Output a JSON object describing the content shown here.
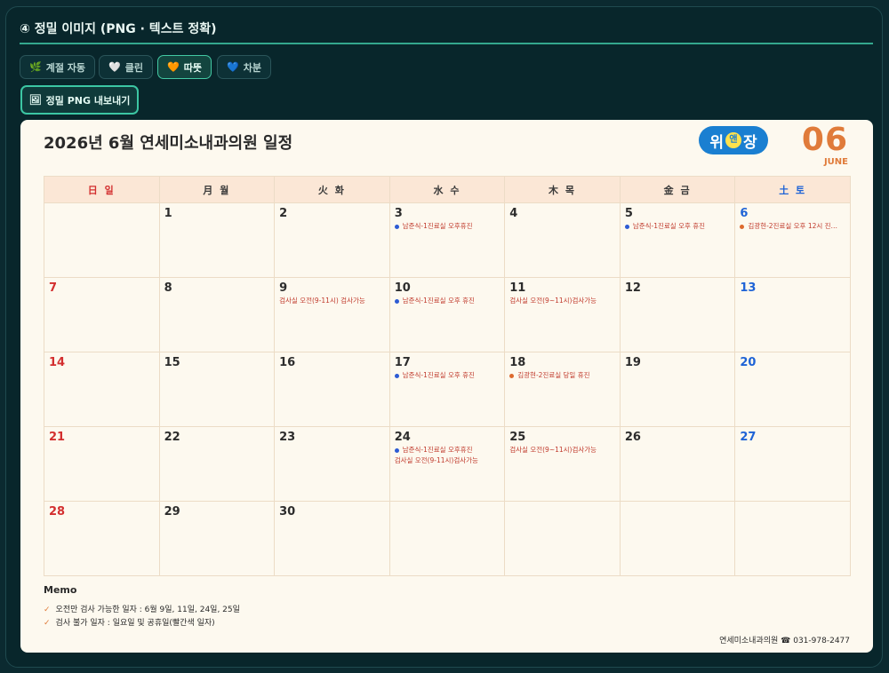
{
  "panel": {
    "title": "④ 정밀 이미지 (PNG · 텍스트 정확)"
  },
  "chips": [
    {
      "icon": "🌿",
      "label": "계절 자동"
    },
    {
      "icon": "🤍",
      "label": "클린"
    },
    {
      "icon": "🧡",
      "label": "따뜻"
    },
    {
      "icon": "💙",
      "label": "차분"
    }
  ],
  "export": {
    "icon": "🖼",
    "label": "정밀 PNG 내보내기"
  },
  "calendar": {
    "title": "2026년 6월 연세미소내과의원 일정",
    "logo": {
      "a": "위",
      "b": "앤",
      "c": "장"
    },
    "month_num": "06",
    "month_name": "JUNE",
    "weekdays": [
      "日 일",
      "月 월",
      "火 화",
      "水 수",
      "木 목",
      "金 금",
      "土 토"
    ],
    "days": {
      "d1": "1",
      "d2": "2",
      "d3": "3",
      "d4": "4",
      "d5": "5",
      "d6": "6",
      "d7": "7",
      "d8": "8",
      "d9": "9",
      "d10": "10",
      "d11": "11",
      "d12": "12",
      "d13": "13",
      "d14": "14",
      "d15": "15",
      "d16": "16",
      "d17": "17",
      "d18": "18",
      "d19": "19",
      "d20": "20",
      "d21": "21",
      "d22": "22",
      "d23": "23",
      "d24": "24",
      "d25": "25",
      "d26": "26",
      "d27": "27",
      "d28": "28",
      "d29": "29",
      "d30": "30"
    },
    "events": {
      "e3": "남준식-1진료실 오후휴진",
      "e5": "남준식-1진료실 오후 휴진",
      "e6": "김광현-2진료실 오후 12시 진…",
      "e9": "검사실 오전(9-11시) 검사가능",
      "e10": "남준식-1진료실 오후 휴진",
      "e11": "검사실 오전(9~11시)검사가능",
      "e17": "남준식-1진료실 오후 휴진",
      "e18": "김광현-2진료실 당일 휴진",
      "e24a": "남준식-1진료실 오후휴진",
      "e24b": "검사실 오전(9-11시)검사가능",
      "e25": "검사실 오전(9~11시)검사가능"
    },
    "memo": {
      "title": "Memo",
      "items": [
        "오전만 검사 가능한 일자 :  6월 9일, 11일, 24일, 25일",
        "검사 불가 일자 : 일요일 및 공휴일(빨간색 일자)"
      ]
    },
    "footer": "연세미소내과의원 ☎ 031-978-2477"
  },
  "colors": {
    "accent": "#3cc0a0",
    "sunday": "#d32f2f",
    "saturday": "#1e63d6",
    "month": "#e07b3a",
    "event_dot_blue": "#2d5bd4",
    "event_dot_orange": "#dd6a2e"
  }
}
